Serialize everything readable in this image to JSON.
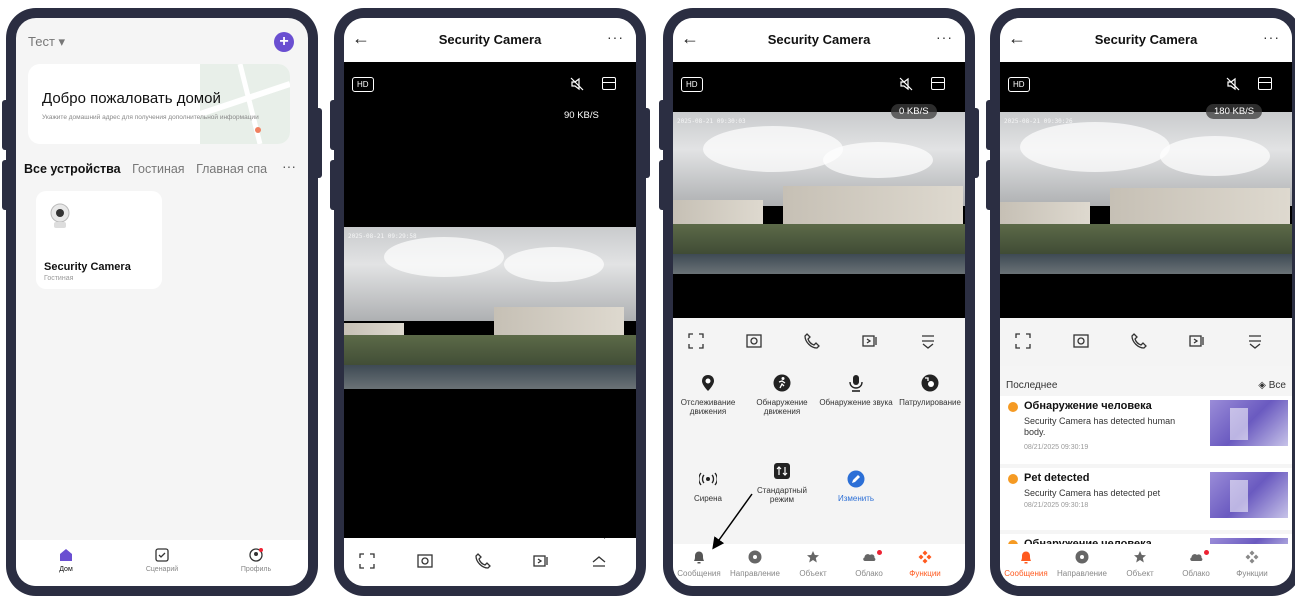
{
  "home": {
    "house_name": "Тест ▾",
    "plus": "+",
    "welcome_title": "Добро пожаловать домой",
    "welcome_sub": "Укажите домашний адрес для получения дополнительной информации",
    "rooms": [
      "Все устройства",
      "Гостиная",
      "Главная спа"
    ],
    "more": "···",
    "device": {
      "name": "Security Camera",
      "room": "Гостиная"
    },
    "tabs": [
      "Дом",
      "Сценарий",
      "Профиль"
    ]
  },
  "camera": {
    "title": "Security Camera",
    "back": "←",
    "more": "···",
    "hd": "HD"
  },
  "phone2": {
    "speed": "90 KB/S",
    "timestamp": "2025-08-21 09:29:58"
  },
  "phone3": {
    "speed": "0 KB/S",
    "timestamp": "2025-08-21 09:30:03",
    "features": [
      {
        "label": "Отслеживание движения",
        "icon": "location-pin-icon"
      },
      {
        "label": "Обнаружение движения",
        "icon": "running-person-icon"
      },
      {
        "label": "Обнаружение звука",
        "icon": "microphone-icon"
      },
      {
        "label": "Патрулирование",
        "icon": "patrol-icon"
      }
    ],
    "features2": [
      {
        "label": "Сирена",
        "icon": "siren-icon"
      },
      {
        "label": "Стандартный режим",
        "icon": "standard-mode-icon"
      },
      {
        "label": "Изменить",
        "icon": "edit-icon"
      }
    ]
  },
  "phone4": {
    "speed": "180 KB/S",
    "timestamp": "2025-08-21 09:30:26",
    "recent": "Последнее",
    "all": "Все",
    "messages": [
      {
        "title": "Обнаружение человека",
        "desc": "Security Camera has detected human body.",
        "time": "08/21/2025 09:30:19"
      },
      {
        "title": "Pet detected",
        "desc": "Security Camera has detected pet",
        "time": "08/21/2025 09:30:18"
      },
      {
        "title": "Обнаружение человека",
        "desc": "",
        "time": ""
      }
    ]
  },
  "cam_tabs": [
    "Сообщения",
    "Направление",
    "Объект",
    "Облако",
    "Функции"
  ],
  "colors": {
    "accent": "#6a4fd1",
    "orange": "#ff5a1f",
    "frame": "#2b2e42",
    "blue": "#2c6fd6",
    "alert": "#f59a23"
  }
}
